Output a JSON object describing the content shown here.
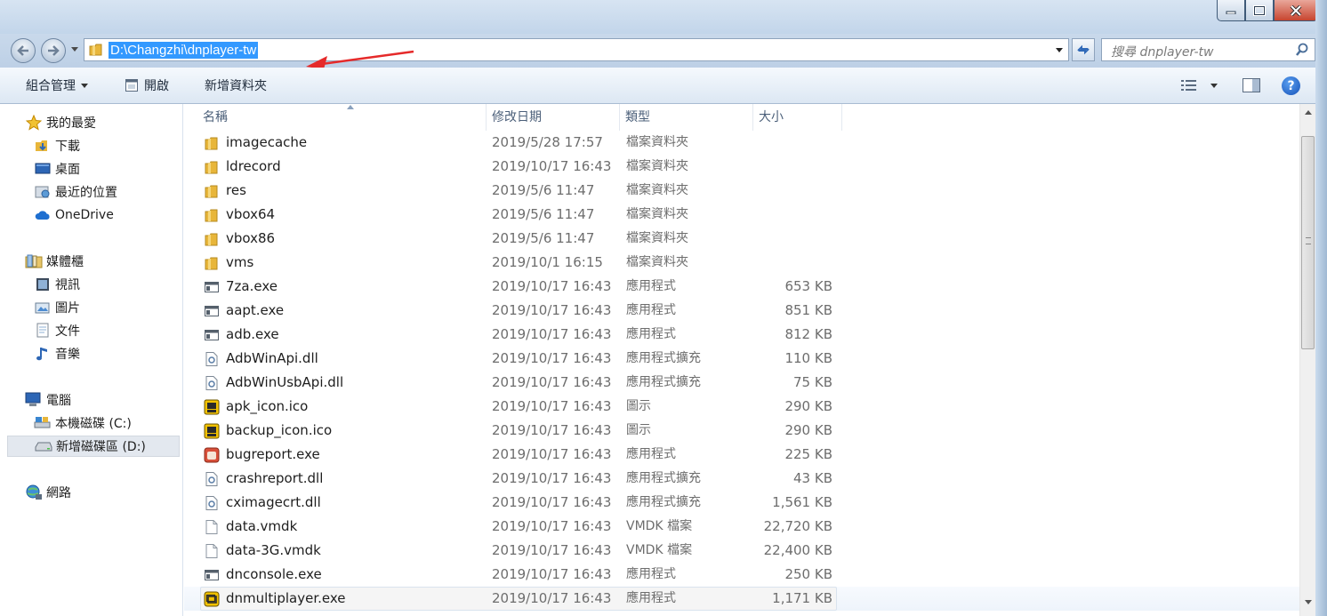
{
  "window": {
    "controls": [
      "minimize-icon",
      "maximize-icon",
      "close-icon"
    ]
  },
  "address": {
    "path": "D:\\Changzhi\\dnplayer-tw",
    "search_placeholder": "搜尋 dnplayer-tw"
  },
  "commands": {
    "organize": "組合管理",
    "open": "開啟",
    "new_folder": "新增資料夾"
  },
  "nav": {
    "favorites": "我的最愛",
    "downloads": "下載",
    "desktop": "桌面",
    "recent": "最近的位置",
    "onedrive": "OneDrive",
    "libraries": "媒體櫃",
    "videos": "視訊",
    "pictures": "圖片",
    "documents": "文件",
    "music": "音樂",
    "computer": "電腦",
    "drive_c": "本機磁碟 (C:)",
    "drive_d": "新增磁碟區 (D:)",
    "network": "網路"
  },
  "columns": {
    "name": "名稱",
    "date": "修改日期",
    "type": "類型",
    "size": "大小"
  },
  "files": [
    {
      "name": "imagecache",
      "date": "2019/5/28 17:57",
      "type": "檔案資料夾",
      "size": "",
      "icon": "folder-icon"
    },
    {
      "name": "ldrecord",
      "date": "2019/10/17 16:43",
      "type": "檔案資料夾",
      "size": "",
      "icon": "folder-icon"
    },
    {
      "name": "res",
      "date": "2019/5/6 11:47",
      "type": "檔案資料夾",
      "size": "",
      "icon": "folder-icon"
    },
    {
      "name": "vbox64",
      "date": "2019/5/6 11:47",
      "type": "檔案資料夾",
      "size": "",
      "icon": "folder-icon"
    },
    {
      "name": "vbox86",
      "date": "2019/5/6 11:47",
      "type": "檔案資料夾",
      "size": "",
      "icon": "folder-icon"
    },
    {
      "name": "vms",
      "date": "2019/10/1 16:15",
      "type": "檔案資料夾",
      "size": "",
      "icon": "folder-icon"
    },
    {
      "name": "7za.exe",
      "date": "2019/10/17 16:43",
      "type": "應用程式",
      "size": "653 KB",
      "icon": "exe-icon"
    },
    {
      "name": "aapt.exe",
      "date": "2019/10/17 16:43",
      "type": "應用程式",
      "size": "851 KB",
      "icon": "exe-icon"
    },
    {
      "name": "adb.exe",
      "date": "2019/10/17 16:43",
      "type": "應用程式",
      "size": "812 KB",
      "icon": "exe-icon"
    },
    {
      "name": "AdbWinApi.dll",
      "date": "2019/10/17 16:43",
      "type": "應用程式擴充",
      "size": "110 KB",
      "icon": "dll-icon"
    },
    {
      "name": "AdbWinUsbApi.dll",
      "date": "2019/10/17 16:43",
      "type": "應用程式擴充",
      "size": "75 KB",
      "icon": "dll-icon"
    },
    {
      "name": "apk_icon.ico",
      "date": "2019/10/17 16:43",
      "type": "圖示",
      "size": "290 KB",
      "icon": "apk-ico-icon"
    },
    {
      "name": "backup_icon.ico",
      "date": "2019/10/17 16:43",
      "type": "圖示",
      "size": "290 KB",
      "icon": "apk-ico-icon"
    },
    {
      "name": "bugreport.exe",
      "date": "2019/10/17 16:43",
      "type": "應用程式",
      "size": "225 KB",
      "icon": "bugreport-icon"
    },
    {
      "name": "crashreport.dll",
      "date": "2019/10/17 16:43",
      "type": "應用程式擴充",
      "size": "43 KB",
      "icon": "dll-icon"
    },
    {
      "name": "cximagecrt.dll",
      "date": "2019/10/17 16:43",
      "type": "應用程式擴充",
      "size": "1,561 KB",
      "icon": "dll-icon"
    },
    {
      "name": "data.vmdk",
      "date": "2019/10/17 16:43",
      "type": "VMDK 檔案",
      "size": "22,720 KB",
      "icon": "file-icon"
    },
    {
      "name": "data-3G.vmdk",
      "date": "2019/10/17 16:43",
      "type": "VMDK 檔案",
      "size": "22,400 KB",
      "icon": "file-icon"
    },
    {
      "name": "dnconsole.exe",
      "date": "2019/10/17 16:43",
      "type": "應用程式",
      "size": "250 KB",
      "icon": "exe-icon"
    },
    {
      "name": "dnmultiplayer.exe",
      "date": "2019/10/17 16:43",
      "type": "應用程式",
      "size": "1,171 KB",
      "icon": "multiplayer-icon"
    }
  ],
  "colors": {
    "selection": "#3399ff",
    "annotation_arrow": "#e52a2a",
    "folder": "#e8b63a"
  }
}
